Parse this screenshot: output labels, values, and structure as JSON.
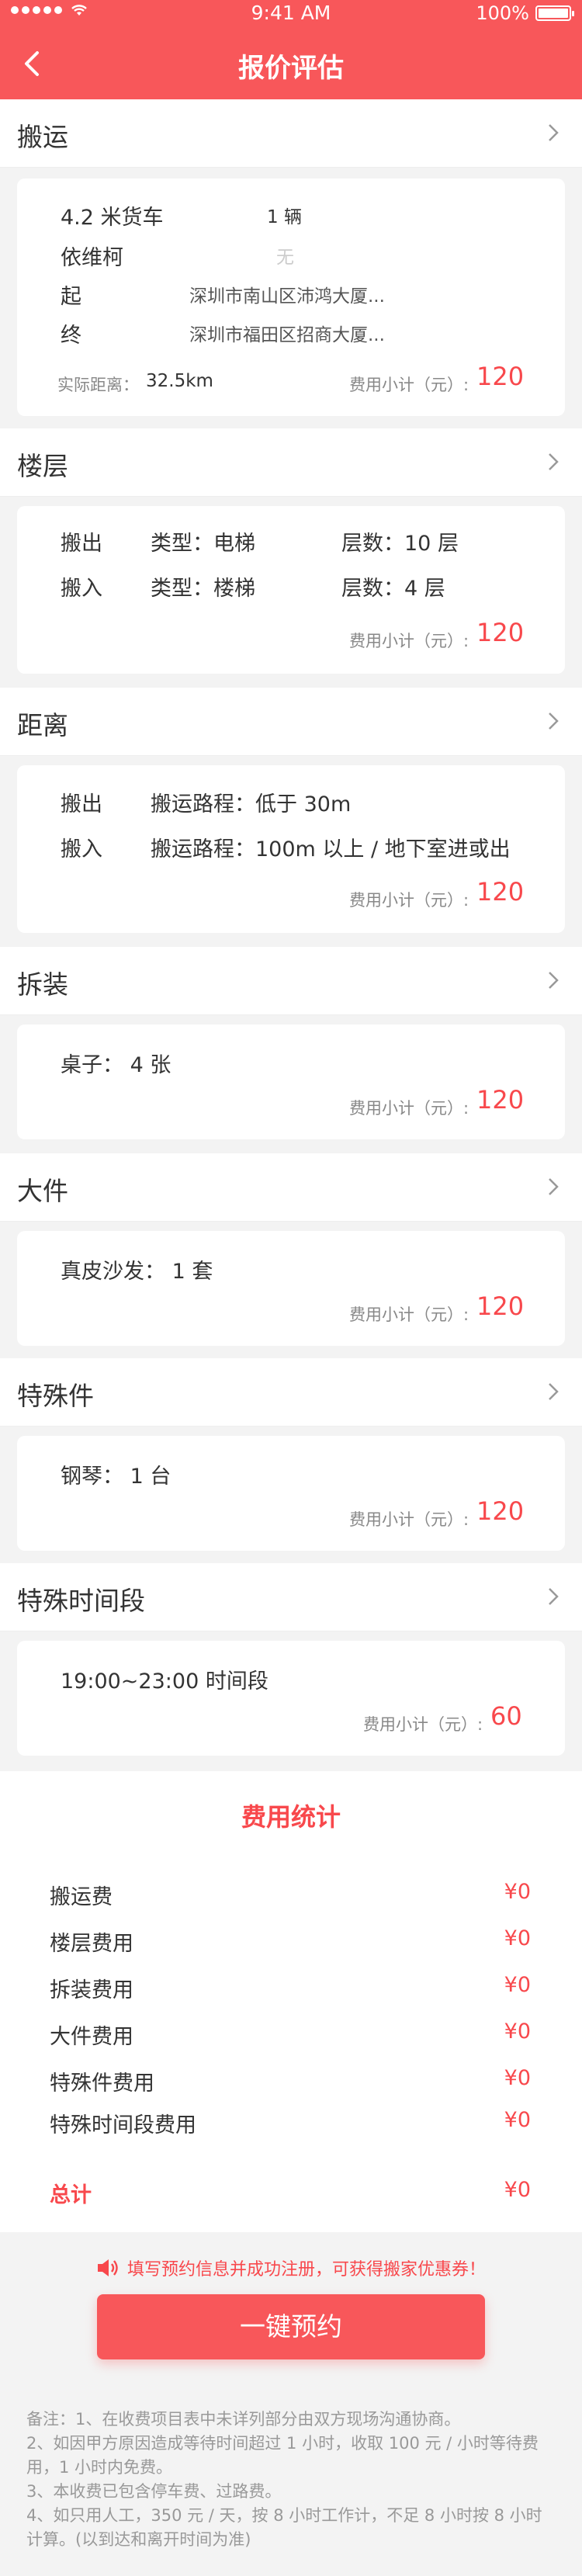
{
  "status_bar": {
    "time": "9:41 AM",
    "battery": "100%"
  },
  "nav": {
    "title": "报价评估"
  },
  "sections": {
    "move": {
      "title": "搬运",
      "vehicle": "4.2 米货车",
      "vehicle_count": "1 辆",
      "helper_label": "依维柯",
      "helper_value": "无",
      "from_label": "起",
      "from_addr": "深圳市南山区沛鸿大厦...",
      "to_label": "终",
      "to_addr": "深圳市福田区招商大厦...",
      "distance_label": "实际距离：",
      "distance": "32.5km",
      "subtotal_label": "费用小计（元）:",
      "subtotal": "120"
    },
    "floor": {
      "title": "楼层",
      "out_label": "搬出",
      "out_type": "类型：电梯",
      "out_floor": "层数：10 层",
      "in_label": "搬入",
      "in_type": "类型：楼梯",
      "in_floor": "层数：4 层",
      "subtotal_label": "费用小计（元）:",
      "subtotal": "120"
    },
    "distance": {
      "title": "距离",
      "out_label": "搬出",
      "out_value": "搬运路程：低于 30m",
      "in_label": "搬入",
      "in_value": "搬运路程：100m 以上 / 地下室进或出",
      "subtotal_label": "费用小计（元）:",
      "subtotal": "120"
    },
    "assembly": {
      "title": "拆装",
      "item": "桌子：  4 张",
      "subtotal_label": "费用小计（元）:",
      "subtotal": "120"
    },
    "large": {
      "title": "大件",
      "item": "真皮沙发：  1 套",
      "subtotal_label": "费用小计（元）:",
      "subtotal": "120"
    },
    "special": {
      "title": "特殊件",
      "item": "钢琴：  1 台",
      "subtotal_label": "费用小计（元）:",
      "subtotal": "120"
    },
    "special_time": {
      "title": "特殊时间段",
      "item": "19:00~23:00 时间段",
      "subtotal_label": "费用小计（元）:",
      "subtotal": "60"
    }
  },
  "stats": {
    "title": "费用统计",
    "rows": [
      {
        "label": "搬运费",
        "value": "¥0"
      },
      {
        "label": "楼层费用",
        "value": "¥0"
      },
      {
        "label": "拆装费用",
        "value": "¥0"
      },
      {
        "label": "大件费用",
        "value": "¥0"
      },
      {
        "label": "特殊件费用",
        "value": "¥0"
      },
      {
        "label": "特殊时间段费用",
        "value": "¥0"
      }
    ],
    "total_label": "总计",
    "total_value": "¥0"
  },
  "notice": "填写预约信息并成功注册，可获得搬家优惠券！",
  "cta": "一键预约",
  "remarks": [
    "备注：1、在收费项目表中未详列部分由双方现场沟通协商。",
    "2、如因甲方原因造成等待时间超过 1 小时，收取 100 元 / 小时等待费用，1 小时内免费。",
    "3、本收费已包含停车费、过路费。",
    "4、如只用人工，350 元 / 天，按 8 小时工作计，不足 8 小时按 8 小时计算。(以到达和离开时间为准)"
  ],
  "colors": {
    "brand": "#f8575a",
    "price": "#f8484c",
    "background": "#f3f3f3"
  },
  "icons": [
    "back-arrow-icon",
    "chevron-right-icon",
    "speaker-icon",
    "wifi-icon",
    "battery-icon"
  ]
}
